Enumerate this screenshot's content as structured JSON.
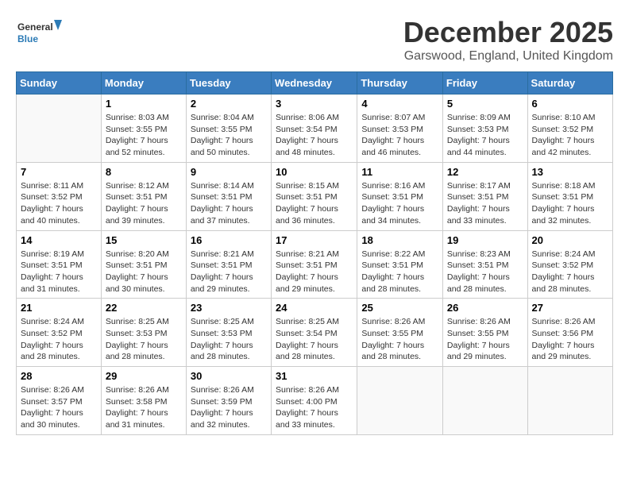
{
  "logo": {
    "line1": "General",
    "line2": "Blue"
  },
  "title": "December 2025",
  "subtitle": "Garswood, England, United Kingdom",
  "days_header": [
    "Sunday",
    "Monday",
    "Tuesday",
    "Wednesday",
    "Thursday",
    "Friday",
    "Saturday"
  ],
  "weeks": [
    [
      {
        "day": "",
        "content": ""
      },
      {
        "day": "1",
        "content": "Sunrise: 8:03 AM\nSunset: 3:55 PM\nDaylight: 7 hours\nand 52 minutes."
      },
      {
        "day": "2",
        "content": "Sunrise: 8:04 AM\nSunset: 3:55 PM\nDaylight: 7 hours\nand 50 minutes."
      },
      {
        "day": "3",
        "content": "Sunrise: 8:06 AM\nSunset: 3:54 PM\nDaylight: 7 hours\nand 48 minutes."
      },
      {
        "day": "4",
        "content": "Sunrise: 8:07 AM\nSunset: 3:53 PM\nDaylight: 7 hours\nand 46 minutes."
      },
      {
        "day": "5",
        "content": "Sunrise: 8:09 AM\nSunset: 3:53 PM\nDaylight: 7 hours\nand 44 minutes."
      },
      {
        "day": "6",
        "content": "Sunrise: 8:10 AM\nSunset: 3:52 PM\nDaylight: 7 hours\nand 42 minutes."
      }
    ],
    [
      {
        "day": "7",
        "content": "Sunrise: 8:11 AM\nSunset: 3:52 PM\nDaylight: 7 hours\nand 40 minutes."
      },
      {
        "day": "8",
        "content": "Sunrise: 8:12 AM\nSunset: 3:51 PM\nDaylight: 7 hours\nand 39 minutes."
      },
      {
        "day": "9",
        "content": "Sunrise: 8:14 AM\nSunset: 3:51 PM\nDaylight: 7 hours\nand 37 minutes."
      },
      {
        "day": "10",
        "content": "Sunrise: 8:15 AM\nSunset: 3:51 PM\nDaylight: 7 hours\nand 36 minutes."
      },
      {
        "day": "11",
        "content": "Sunrise: 8:16 AM\nSunset: 3:51 PM\nDaylight: 7 hours\nand 34 minutes."
      },
      {
        "day": "12",
        "content": "Sunrise: 8:17 AM\nSunset: 3:51 PM\nDaylight: 7 hours\nand 33 minutes."
      },
      {
        "day": "13",
        "content": "Sunrise: 8:18 AM\nSunset: 3:51 PM\nDaylight: 7 hours\nand 32 minutes."
      }
    ],
    [
      {
        "day": "14",
        "content": "Sunrise: 8:19 AM\nSunset: 3:51 PM\nDaylight: 7 hours\nand 31 minutes."
      },
      {
        "day": "15",
        "content": "Sunrise: 8:20 AM\nSunset: 3:51 PM\nDaylight: 7 hours\nand 30 minutes."
      },
      {
        "day": "16",
        "content": "Sunrise: 8:21 AM\nSunset: 3:51 PM\nDaylight: 7 hours\nand 29 minutes."
      },
      {
        "day": "17",
        "content": "Sunrise: 8:21 AM\nSunset: 3:51 PM\nDaylight: 7 hours\nand 29 minutes."
      },
      {
        "day": "18",
        "content": "Sunrise: 8:22 AM\nSunset: 3:51 PM\nDaylight: 7 hours\nand 28 minutes."
      },
      {
        "day": "19",
        "content": "Sunrise: 8:23 AM\nSunset: 3:51 PM\nDaylight: 7 hours\nand 28 minutes."
      },
      {
        "day": "20",
        "content": "Sunrise: 8:24 AM\nSunset: 3:52 PM\nDaylight: 7 hours\nand 28 minutes."
      }
    ],
    [
      {
        "day": "21",
        "content": "Sunrise: 8:24 AM\nSunset: 3:52 PM\nDaylight: 7 hours\nand 28 minutes."
      },
      {
        "day": "22",
        "content": "Sunrise: 8:25 AM\nSunset: 3:53 PM\nDaylight: 7 hours\nand 28 minutes."
      },
      {
        "day": "23",
        "content": "Sunrise: 8:25 AM\nSunset: 3:53 PM\nDaylight: 7 hours\nand 28 minutes."
      },
      {
        "day": "24",
        "content": "Sunrise: 8:25 AM\nSunset: 3:54 PM\nDaylight: 7 hours\nand 28 minutes."
      },
      {
        "day": "25",
        "content": "Sunrise: 8:26 AM\nSunset: 3:55 PM\nDaylight: 7 hours\nand 28 minutes."
      },
      {
        "day": "26",
        "content": "Sunrise: 8:26 AM\nSunset: 3:55 PM\nDaylight: 7 hours\nand 29 minutes."
      },
      {
        "day": "27",
        "content": "Sunrise: 8:26 AM\nSunset: 3:56 PM\nDaylight: 7 hours\nand 29 minutes."
      }
    ],
    [
      {
        "day": "28",
        "content": "Sunrise: 8:26 AM\nSunset: 3:57 PM\nDaylight: 7 hours\nand 30 minutes."
      },
      {
        "day": "29",
        "content": "Sunrise: 8:26 AM\nSunset: 3:58 PM\nDaylight: 7 hours\nand 31 minutes."
      },
      {
        "day": "30",
        "content": "Sunrise: 8:26 AM\nSunset: 3:59 PM\nDaylight: 7 hours\nand 32 minutes."
      },
      {
        "day": "31",
        "content": "Sunrise: 8:26 AM\nSunset: 4:00 PM\nDaylight: 7 hours\nand 33 minutes."
      },
      {
        "day": "",
        "content": ""
      },
      {
        "day": "",
        "content": ""
      },
      {
        "day": "",
        "content": ""
      }
    ]
  ]
}
